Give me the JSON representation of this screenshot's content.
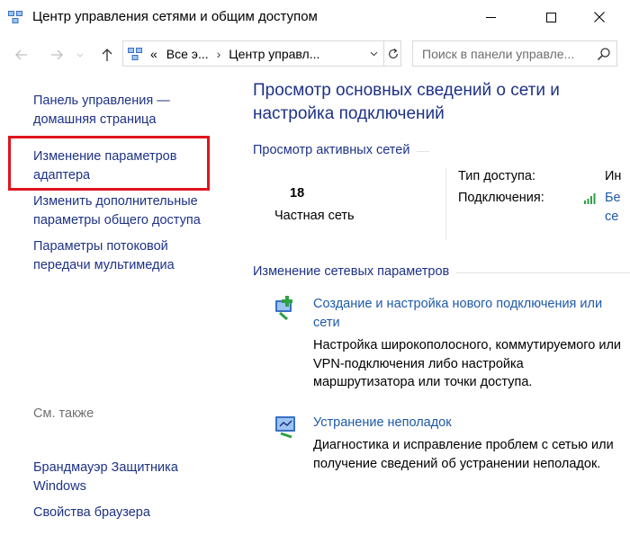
{
  "window": {
    "title": "Центр управления сетями и общим доступом"
  },
  "address_bar": {
    "overflow": "«",
    "crumbs": [
      "Все э...",
      "Центр управл..."
    ],
    "search_placeholder": "Поиск в панели управле..."
  },
  "sidebar": {
    "links": [
      "Панель управления — домашняя страница",
      "Изменение параметров адаптера",
      "Изменить дополнительные параметры общего доступа",
      "Параметры потоковой передачи мультимедиа"
    ],
    "see_also_label": "См. также",
    "see_also_links": [
      "Брандмауэр Защитника Windows",
      "Свойства браузера"
    ],
    "highlight_color": "#e0141e"
  },
  "main": {
    "title": "Просмотр основных сведений о сети и настройка подключений",
    "active_networks_header": "Просмотр активных сетей",
    "network": {
      "name": "18",
      "type": "Частная сеть",
      "access_label": "Тип доступа:",
      "access_value": "Ин",
      "connections_label": "Подключения:",
      "connection_link_line1": "Бе",
      "connection_link_line2": "се"
    },
    "change_settings_header": "Изменение сетевых параметров",
    "tasks": [
      {
        "icon": "new-connection-icon",
        "title": "Создание и настройка нового подключения или сети",
        "description": "Настройка широкополосного, коммутируемого или VPN-подключения либо настройка маршрутизатора или точки доступа."
      },
      {
        "icon": "troubleshoot-icon",
        "title": "Устранение неполадок",
        "description": "Диагностика и исправление проблем с сетью или получение сведений об устранении неполадок."
      }
    ]
  },
  "colors": {
    "link": "#1e5aa8",
    "heading": "#1e3287",
    "signal_green": "#2ea043"
  }
}
